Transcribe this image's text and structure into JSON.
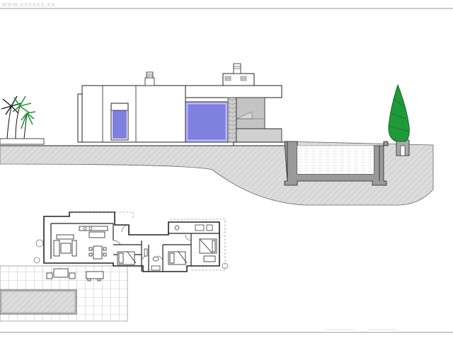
{
  "watermark": "www.xxxxxx.xx",
  "drawing": {
    "views": [
      "elevation-section",
      "floor-plan"
    ]
  },
  "colors": {
    "line": "#222222",
    "ground_fill": "#d9d9d9",
    "wall_shade": "#c4c4c4",
    "glazing": "#8080e0",
    "vegetation": "#1f9a3a",
    "frame_border": "#9a9a9a"
  }
}
